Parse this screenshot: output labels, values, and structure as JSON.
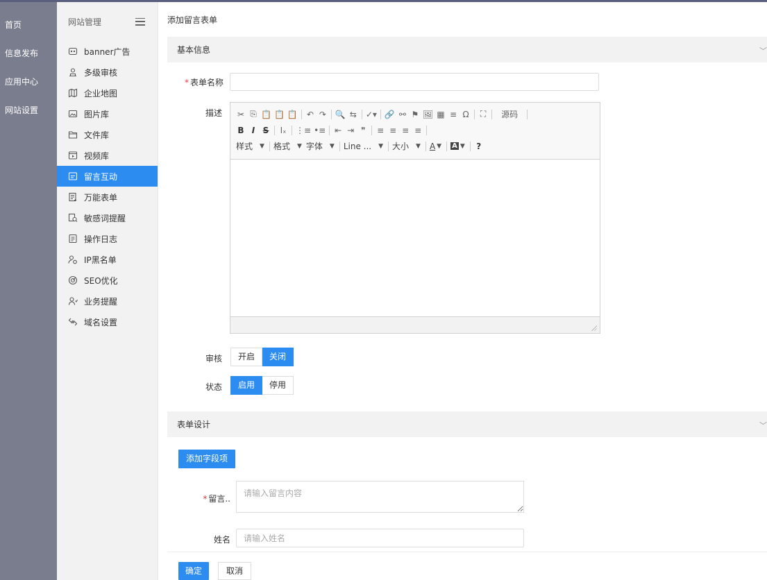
{
  "left_nav": [
    "首页",
    "信息发布",
    "应用中心",
    "网站设置"
  ],
  "sidebar": {
    "title": "网站管理",
    "items": [
      {
        "label": "banner广告",
        "icon": "banner-icon"
      },
      {
        "label": "多级审核",
        "icon": "audit-icon"
      },
      {
        "label": "企业地图",
        "icon": "map-icon"
      },
      {
        "label": "图片库",
        "icon": "image-library-icon"
      },
      {
        "label": "文件库",
        "icon": "folder-icon"
      },
      {
        "label": "视频库",
        "icon": "video-icon"
      },
      {
        "label": "留言互动",
        "icon": "message-icon"
      },
      {
        "label": "万能表单",
        "icon": "form-icon"
      },
      {
        "label": "敏感词提醒",
        "icon": "sensitive-word-icon"
      },
      {
        "label": "操作日志",
        "icon": "log-icon"
      },
      {
        "label": "IP黑名单",
        "icon": "blacklist-icon"
      },
      {
        "label": "SEO优化",
        "icon": "seo-icon"
      },
      {
        "label": "业务提醒",
        "icon": "reminder-icon"
      },
      {
        "label": "域名设置",
        "icon": "domain-icon"
      }
    ],
    "active_index": 6
  },
  "page": {
    "breadcrumb": "添加留言表单",
    "section_basic": "基本信息",
    "form_name_label": "表单名称",
    "form_name_value": "",
    "desc_label": "描述",
    "editor": {
      "row1": [
        "✂",
        "⎘",
        "📋",
        "📋",
        "📋",
        "|",
        "↶",
        "↷",
        "|",
        "🔍",
        "⇆",
        "|",
        "✓▾",
        "|",
        "🔗",
        "⚯",
        "⚑",
        "🖼",
        "▦",
        "≡",
        "Ω",
        "|",
        "⛶",
        "|"
      ],
      "source_label": "源码",
      "row2": [
        "B",
        "I",
        "S",
        "|",
        "Iₓ",
        "|",
        "⋮≡",
        "•≡",
        "|",
        "⇤",
        "⇥",
        "❞",
        "|",
        "≡",
        "≡",
        "≡",
        "≡",
        "|"
      ],
      "style_label": "样式",
      "format_label": "格式",
      "font_label": "字体",
      "line_label": "Line ...",
      "size_label": "大小",
      "text_color_label": "A",
      "bg_color_label": "A",
      "help_label": "?"
    },
    "audit_label": "审核",
    "audit_options": [
      "开启",
      "关闭"
    ],
    "audit_selected": 1,
    "status_label": "状态",
    "status_options": [
      "启用",
      "停用"
    ],
    "status_selected": 0,
    "section_design": "表单设计",
    "add_field_button": "添加字段项",
    "message_label": "留言..",
    "message_placeholder": "请输入留言内容",
    "name_label": "姓名",
    "name_placeholder": "请输入姓名",
    "confirm_button": "确定",
    "cancel_button": "取消"
  },
  "colors": {
    "accent": "#2d8cf0",
    "left_nav_bg": "#7a7d8d",
    "sidebar_bg": "#f2f2f2",
    "required": "#e4393c"
  }
}
